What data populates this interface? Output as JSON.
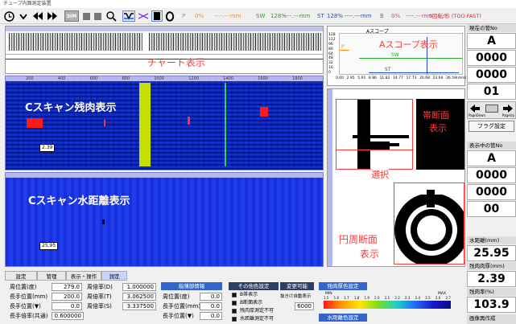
{
  "window": {
    "title": "チューブ内面測定装置"
  },
  "toolbar": {
    "sim_label": "SIM",
    "p_label": "P",
    "p_percent": "0%",
    "p_mm": "----.---mm",
    "sw_label": "SW",
    "sw_percent": "128%",
    "sw_mm": "----.---mm",
    "st_label": "ST",
    "st_percent": "128%",
    "st_mm": "----.---mm",
    "b_label": "B",
    "b_percent": "0%",
    "b_mm": "----.---mm",
    "speed_text": "0回転/秒 (TOO FAST)"
  },
  "chart_panel": {
    "label": "チャート表示"
  },
  "ascope": {
    "title": "Aスコープ",
    "label": "Aスコープ表示",
    "y_ticks": [
      "128",
      "112",
      "96",
      "80",
      "64",
      "48",
      "32",
      "16",
      "0"
    ],
    "x_ticks": [
      "0.00",
      "2.95",
      "5.91",
      "8.86",
      "11.82",
      "14.77",
      "17.73",
      "20.68",
      "23.64",
      "26.59"
    ],
    "x_unit": "(mm)",
    "markers": [
      "P",
      "SW",
      "ST"
    ]
  },
  "cscan_thickness": {
    "label": "Cスキャン残肉表示",
    "value": "2.39",
    "ruler_ticks": [
      "200",
      "400",
      "600",
      "800",
      "1000",
      "1200",
      "1400",
      "1600",
      "1800"
    ]
  },
  "cscan_distance": {
    "label": "Cスキャン水距離表示",
    "value": "25.95"
  },
  "section": {
    "band_label_1": "帯断面",
    "band_label_2": "表示",
    "select_label": "選択",
    "circ_label_1": "円周断面",
    "circ_label_2": "表示"
  },
  "right_panel": {
    "current_tube_title": "現在の管No",
    "current_tube": [
      "A",
      "0000",
      "0000",
      "01"
    ],
    "pagedown": "PageDown",
    "pageup": "PageUp",
    "flag_button": "フラグ設定",
    "display_tube_title": "表示中の管No",
    "display_tube": [
      "A",
      "0000",
      "0000",
      "00"
    ],
    "water_dist_title": "水距離(mm)",
    "water_dist": "25.95",
    "thickness_title": "残肉肉厚(mm)",
    "thickness": "2.39",
    "thickness_pct_title": "残肉率(%)",
    "thickness_pct": "103.9",
    "image_op_title": "画像再作成"
  },
  "tabs": [
    "設定",
    "管理",
    "表示・操作",
    "測定"
  ],
  "bottom": {
    "col1": [
      {
        "label": "周位置(度)",
        "value": "279.0"
      },
      {
        "label": "長手位置(mm)",
        "value": "200.0"
      },
      {
        "label": "長手位置(▼)",
        "value": "0.0"
      },
      {
        "label": "長手倍率(共通)",
        "value": "0.600000"
      }
    ],
    "col2": [
      {
        "label": "周倍率(D)",
        "value": "1.000000"
      },
      {
        "label": "周倍率(T)",
        "value": "3.062500"
      },
      {
        "label": "周倍率(S)",
        "value": "3.337500"
      }
    ],
    "col3_head": "指薄部情報",
    "col3": [
      {
        "label": "周位置(度)",
        "value": "0.0"
      },
      {
        "label": "長手位置(mm)",
        "value": "0.0"
      },
      {
        "label": "長手位置(▼)",
        "value": "0.0"
      }
    ],
    "col4_head": "その他色設定",
    "col4": [
      "B帯表示",
      "B断面表示",
      "残肉厚測定不可",
      "水距離測定不可"
    ],
    "col5_head": "変更可能",
    "col5_sub": "抜きけ自動表示",
    "col5_value": "6000",
    "col6_head": "残肉厚色設定",
    "legend_min": "MIN",
    "legend_max": "MAX",
    "legend_ticks": [
      "1.5",
      "1.6",
      "1.7",
      "1.8",
      "1.9",
      "2.0",
      "2.1",
      "2.2",
      "2.3",
      "2.4",
      "2.5",
      "2.6",
      "2.7"
    ],
    "col6_head2": "水距離色設定"
  }
}
